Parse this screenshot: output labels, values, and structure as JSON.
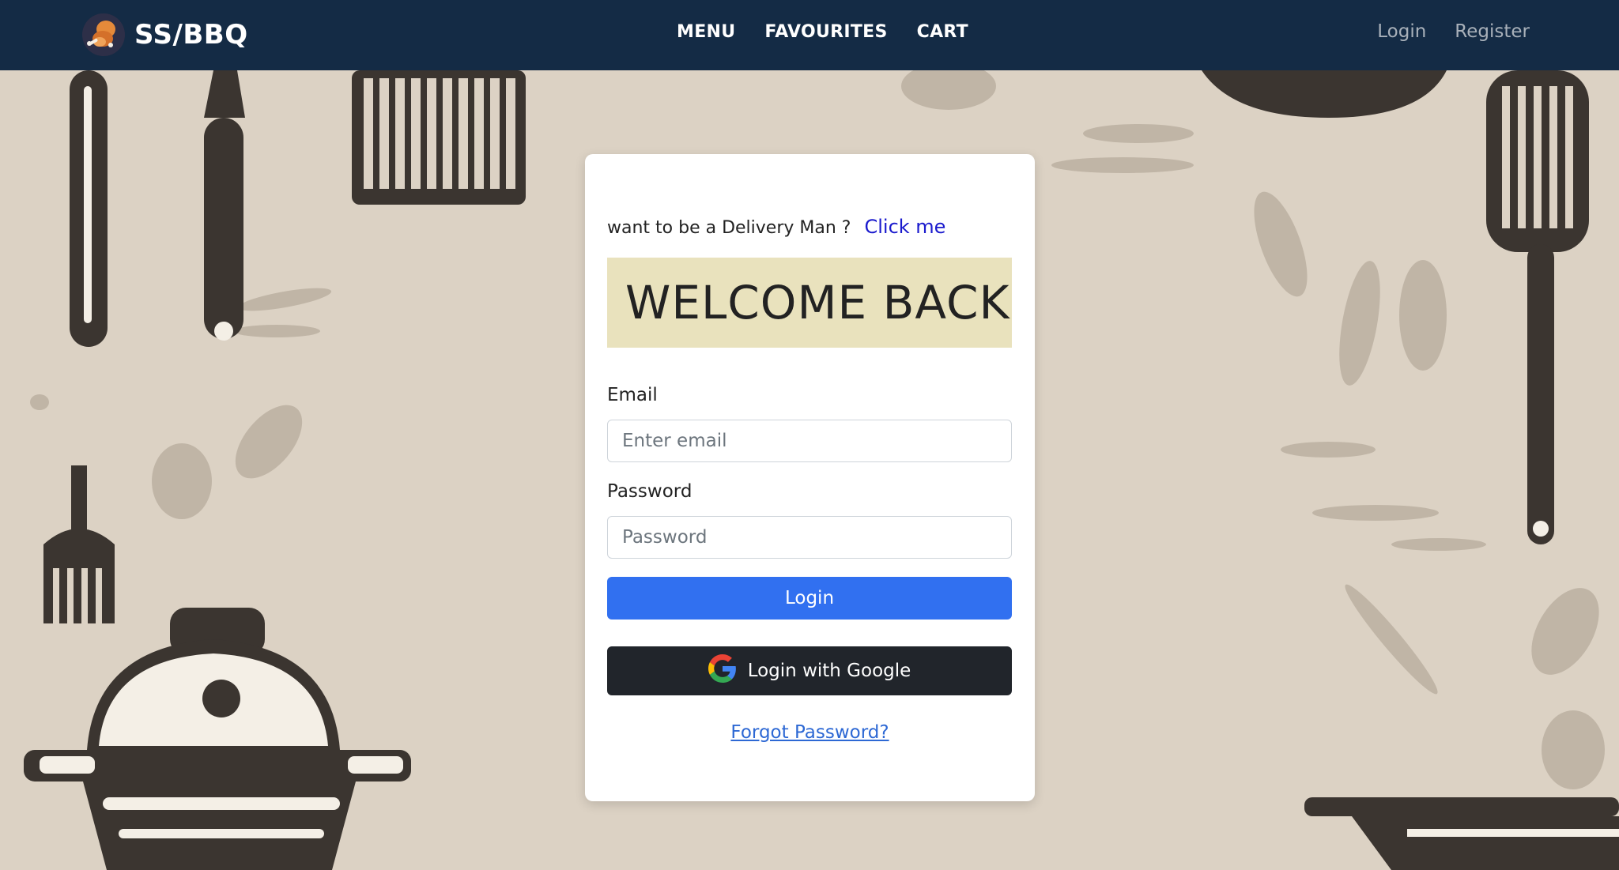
{
  "navbar": {
    "brand": "SS/BBQ",
    "links": [
      "MENU",
      "FAVOURITES",
      "CART"
    ],
    "login_label": "Login",
    "register_label": "Register"
  },
  "login_card": {
    "delivery_prompt": "want to be a Delivery Man ?",
    "delivery_link": "Click me",
    "welcome_heading": "WELCOME BACK",
    "email_label": "Email",
    "email_placeholder": "Enter email",
    "email_value": "",
    "password_label": "Password",
    "password_placeholder": "Password",
    "password_value": "",
    "login_button": "Login",
    "google_button": "Login with Google",
    "forgot_password": "Forgot Password?"
  },
  "colors": {
    "navbar_bg": "#142b45",
    "page_bg": "#dcd2c4",
    "welcome_bg": "#e9e2bd",
    "login_button_bg": "#3170f0",
    "google_button_bg": "#21252b",
    "link_color": "#1a1acd"
  },
  "icons": [
    "bbq-chicken-logo-icon",
    "google-g-icon"
  ]
}
